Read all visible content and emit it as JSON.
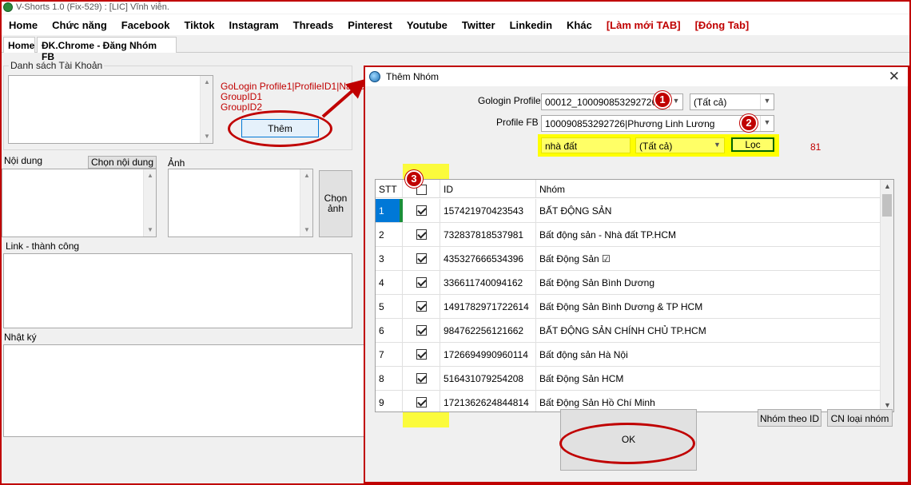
{
  "window": {
    "title": "V-Shorts 1.0 (Fix-529) : [LIC] Vĩnh viễn."
  },
  "menu": [
    {
      "label": "Home",
      "red": false
    },
    {
      "label": "Chức năng",
      "red": false
    },
    {
      "label": "Facebook",
      "red": false
    },
    {
      "label": "Tiktok",
      "red": false
    },
    {
      "label": "Instagram",
      "red": false
    },
    {
      "label": "Threads",
      "red": false
    },
    {
      "label": "Pinterest",
      "red": false
    },
    {
      "label": "Youtube",
      "red": false
    },
    {
      "label": "Twitter",
      "red": false
    },
    {
      "label": "Linkedin",
      "red": false
    },
    {
      "label": "Khác",
      "red": false
    },
    {
      "label": "[Làm mới TAB]",
      "red": true
    },
    {
      "label": "[Đóng Tab]",
      "red": true
    }
  ],
  "tabs": {
    "home": "Home",
    "active": "ĐK.Chrome - Đăng Nhóm FB"
  },
  "left": {
    "accounts_label": "Danh sách Tài Khoản",
    "format_hint_1": "GoLogin Profile1|ProfileID1|Name",
    "format_hint_2": "GroupID1",
    "format_hint_3": "GroupID2",
    "add_button": "Thêm",
    "content_label": "Nội dung",
    "choose_content_button": "Chọn nội dung",
    "image_label": "Ảnh",
    "choose_image_button_line1": "Chọn",
    "choose_image_button_line2": "ảnh",
    "link_label": "Link - thành công",
    "log_label": "Nhật ký"
  },
  "dialog": {
    "title": "Thêm Nhóm",
    "gologin_label": "Gologin Profile",
    "gologin_value": "00012_100090853292726",
    "gologin_filter": "(Tất cả)",
    "profile_label": "Profile FB",
    "profile_value": "100090853292726|Phương Linh Lương",
    "search_value": "nhà đất",
    "search_filter": "(Tất cả)",
    "filter_button": "Lọc",
    "count": "81",
    "badge1": "1",
    "badge2": "2",
    "badge3": "3",
    "columns": {
      "stt": "STT",
      "id": "ID",
      "name": "Nhóm"
    },
    "rows": [
      {
        "stt": "1",
        "id": "157421970423543",
        "name": "BẤT ĐỘNG SẢN"
      },
      {
        "stt": "2",
        "id": "732837818537981",
        "name": "Bất động sản - Nhà đất TP.HCM"
      },
      {
        "stt": "3",
        "id": "435327666534396",
        "name": "Bất Động Sản ☑"
      },
      {
        "stt": "4",
        "id": "336611740094162",
        "name": "Bất Động Sản Bình Dương"
      },
      {
        "stt": "5",
        "id": "1491782971722614",
        "name": "Bất Động Sản Bình Dương & TP HCM"
      },
      {
        "stt": "6",
        "id": "984762256121662",
        "name": "BẤT ĐỘNG SẢN CHÍNH CHỦ TP.HCM"
      },
      {
        "stt": "7",
        "id": "1726694990960114",
        "name": "Bất động sản Hà Nội"
      },
      {
        "stt": "8",
        "id": "516431079254208",
        "name": "Bất Động Sản HCM"
      },
      {
        "stt": "9",
        "id": "1721362624844814",
        "name": "Bất Động Sản Hồ Chí Minh"
      }
    ],
    "group_by_id_button": "Nhóm theo ID",
    "filter_groups_button": "CN loại nhóm",
    "ok_button": "OK"
  },
  "colors": {
    "accent_red": "#c00000",
    "highlight_yellow": "#ffff00",
    "selected_row": "#0078d7"
  }
}
